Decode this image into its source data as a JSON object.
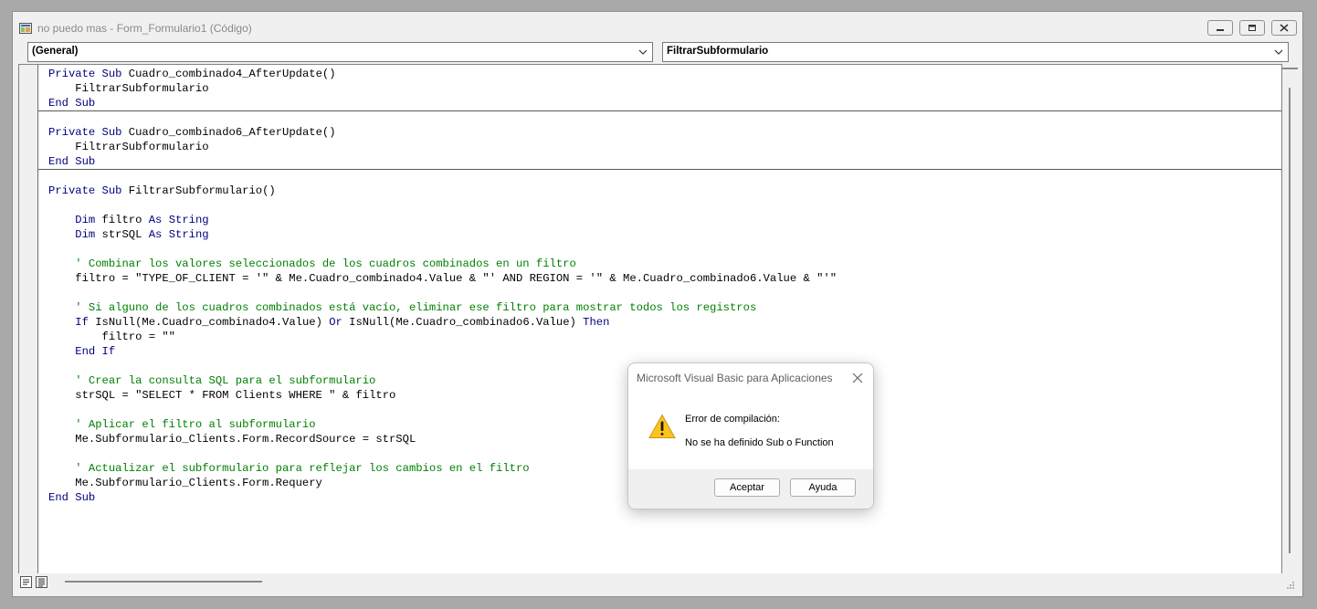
{
  "window": {
    "title": "no puedo mas - Form_Formulario1 (Código)"
  },
  "object_combo": {
    "value": "(General)"
  },
  "procedure_combo": {
    "value": "FiltrarSubformulario"
  },
  "code_lines": [
    "Private Sub Cuadro_combinado4_AfterUpdate()",
    "    FiltrarSubformulario",
    "End Sub",
    "",
    "Private Sub Cuadro_combinado6_AfterUpdate()",
    "    FiltrarSubformulario",
    "End Sub",
    "",
    "Private Sub FiltrarSubformulario()",
    "",
    "    Dim filtro As String",
    "    Dim strSQL As String",
    "",
    "    ' Combinar los valores seleccionados de los cuadros combinados en un filtro",
    "    filtro = \"TYPE_OF_CLIENT = '\" & Me.Cuadro_combinado4.Value & \"' AND REGION = '\" & Me.Cuadro_combinado6.Value & \"'\"",
    "",
    "    ' Si alguno de los cuadros combinados está vacío, eliminar ese filtro para mostrar todos los registros",
    "    If IsNull(Me.Cuadro_combinado4.Value) Or IsNull(Me.Cuadro_combinado6.Value) Then",
    "        filtro = \"\"",
    "    End If",
    "",
    "    ' Crear la consulta SQL para el subformulario",
    "    strSQL = \"SELECT * FROM Clients WHERE \" & filtro",
    "",
    "    ' Aplicar el filtro al subformulario",
    "    Me.Subformulario_Clients.Form.RecordSource = strSQL",
    "",
    "    ' Actualizar el subformulario para reflejar los cambios en el filtro",
    "    Me.Subformulario_Clients.Form.Requery",
    "End Sub"
  ],
  "colors": {
    "keyword": "#00007f",
    "comment": "#008000",
    "warning": "#fcc419"
  },
  "dialog": {
    "title": "Microsoft Visual Basic para Aplicaciones",
    "message_title": "Error de compilación:",
    "message": "No se ha definido Sub o Function",
    "ok_label": "Aceptar",
    "help_label": "Ayuda",
    "icon": "warning-icon"
  }
}
